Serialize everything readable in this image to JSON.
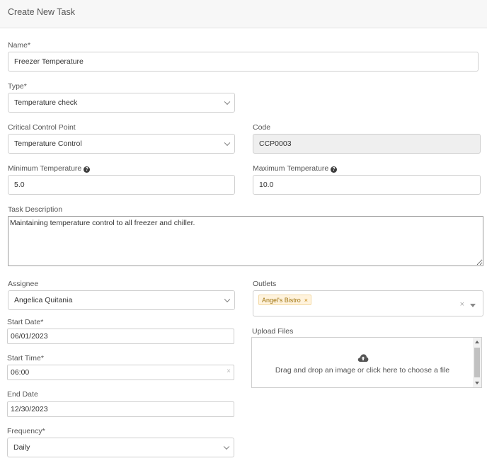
{
  "header": {
    "title": "Create New Task"
  },
  "form": {
    "name": {
      "label": "Name*",
      "value": "Freezer Temperature"
    },
    "type": {
      "label": "Type*",
      "value": "Temperature check"
    },
    "ccp": {
      "label": "Critical Control Point",
      "value": "Temperature Control"
    },
    "code": {
      "label": "Code",
      "value": "CCP0003"
    },
    "min_temp": {
      "label": "Minimum Temperature",
      "value": "5.0"
    },
    "max_temp": {
      "label": "Maximum Temperature",
      "value": "10.0"
    },
    "description": {
      "label": "Task Description",
      "value": "Maintaining temperature control to all freezer and chiller."
    },
    "assignee": {
      "label": "Assignee",
      "value": "Angelica Quitania"
    },
    "outlets": {
      "label": "Outlets",
      "tags": [
        "Angel's Bistro"
      ]
    },
    "start_date": {
      "label": "Start Date*",
      "value": "06/01/2023"
    },
    "start_time": {
      "label": "Start Time*",
      "value": "06:00"
    },
    "end_date": {
      "label": "End Date",
      "value": "12/30/2023"
    },
    "frequency": {
      "label": "Frequency*",
      "value": "Daily"
    },
    "upload": {
      "label": "Upload Files",
      "message": "Drag and drop an image or click here to choose a file"
    }
  },
  "icons": {
    "help": "?",
    "remove": "×",
    "clear": "×"
  }
}
